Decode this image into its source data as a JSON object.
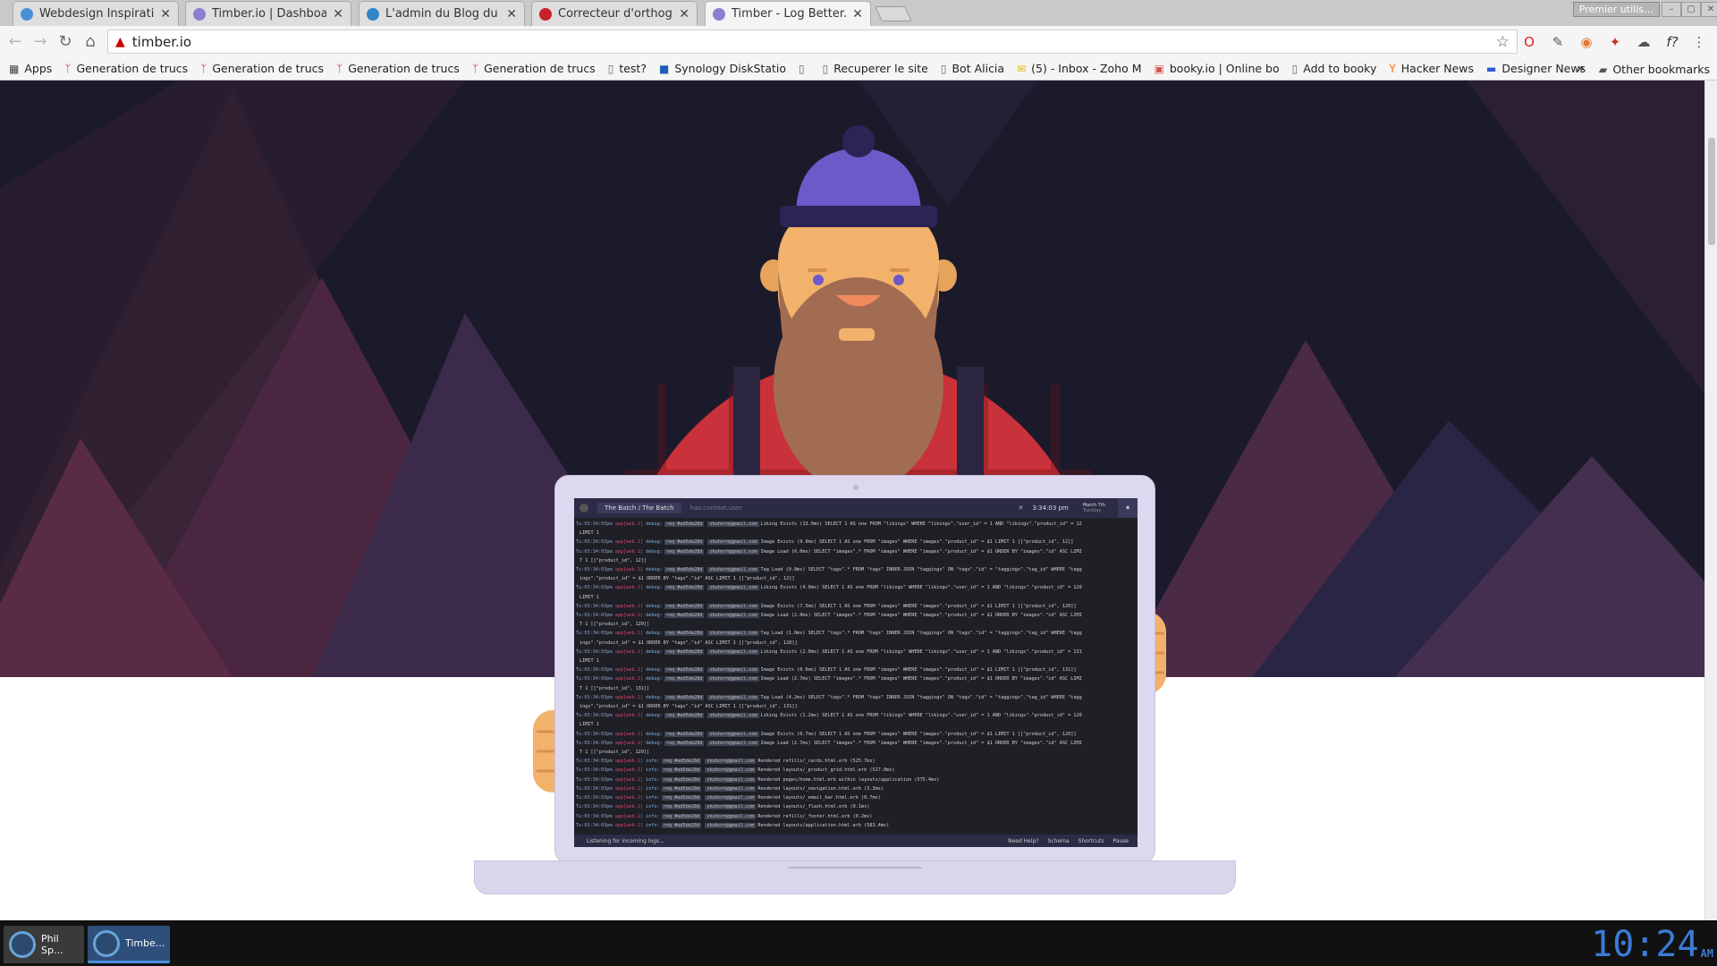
{
  "tabs": [
    {
      "title": "Webdesign Inspiration",
      "active": false,
      "favicon_color": "#4a90d9"
    },
    {
      "title": "Timber.io | Dashboard",
      "active": false,
      "favicon_color": "#8a7fd0"
    },
    {
      "title": "L'admin du Blog du We",
      "active": false,
      "favicon_color": "#2f86c9"
    },
    {
      "title": "Correcteur d'orthograp",
      "active": false,
      "favicon_color": "#c8212b"
    },
    {
      "title": "Timber - Log Better. Sc",
      "active": true,
      "favicon_color": "#8a7fd0"
    }
  ],
  "window": {
    "premier_label": "Premier utilis…"
  },
  "toolbar": {
    "url": "timber.io"
  },
  "bookmarks": [
    {
      "label": "Apps",
      "icon": "apps-grid-icon",
      "color": "#444"
    },
    {
      "label": "Generation de trucs",
      "icon": "bookmark-logo-icon",
      "color": "#c0392b"
    },
    {
      "label": "Generation de trucs",
      "icon": "bookmark-logo-icon",
      "color": "#c0392b"
    },
    {
      "label": "Generation de trucs",
      "icon": "bookmark-logo-icon",
      "color": "#c0392b"
    },
    {
      "label": "Generation de trucs",
      "icon": "bookmark-logo-icon",
      "color": "#c0392b"
    },
    {
      "label": "test?",
      "icon": "page-icon",
      "color": "#666"
    },
    {
      "label": "Synology DiskStatio",
      "icon": "dsm-icon",
      "color": "#1b5fb4"
    },
    {
      "label": "",
      "icon": "page-icon",
      "color": "#666"
    },
    {
      "label": "Recuperer le site",
      "icon": "page-icon",
      "color": "#666"
    },
    {
      "label": "Bot Alicia",
      "icon": "page-icon",
      "color": "#666"
    },
    {
      "label": "(5) - Inbox - Zoho M",
      "icon": "mail-icon",
      "color": "#e6b800"
    },
    {
      "label": "booky.io | Online bo",
      "icon": "booky-icon",
      "color": "#d9534f"
    },
    {
      "label": "Add to booky",
      "icon": "page-icon",
      "color": "#666"
    },
    {
      "label": "Hacker News",
      "icon": "hn-icon",
      "color": "#ff6600"
    },
    {
      "label": "Designer News",
      "icon": "dn-icon",
      "color": "#2d5bd6"
    }
  ],
  "bookmarks_more": "»",
  "other_bookmarks": "Other bookmarks",
  "screen": {
    "source": "The Batch / The Batch",
    "search_placeholder": "has:context.user",
    "time": "3:34:03 pm",
    "date": "March 7th",
    "date_sub": "Tuesday",
    "status": "Listening for incoming logs...",
    "footer_help": "Need Help?",
    "footer_schema": "Schema",
    "footer_shortcuts": "Shortcuts",
    "footer_pause": "Pause"
  },
  "logs": [
    {
      "ts": "Tu:03:34:03pm",
      "app": "app[web.1]",
      "lvl": "debug:",
      "msg": "Liking Exists (13.0ms) SELECT 1 AS one FROM \"likings\" WHERE \"likings\".\"user_id\" = 1 AND \"likings\".\"product_id\" = 12"
    },
    {
      "ts": "",
      "app": "",
      "lvl": "",
      "msg": "LIMIT 1"
    },
    {
      "ts": "Tu:03:34:03pm",
      "app": "app[web.1]",
      "lvl": "debug:",
      "msg": "Image Exists (9.0ms) SELECT 1 AS one FROM \"images\" WHERE \"images\".\"product_id\" = $1 LIMIT 1 [[\"product_id\", 12]]"
    },
    {
      "ts": "Tu:03:34:03pm",
      "app": "app[web.1]",
      "lvl": "debug:",
      "msg": "Image Load (6.0ms) SELECT \"images\".* FROM \"images\" WHERE \"images\".\"product_id\" = $1 ORDER BY \"images\".\"id\" ASC LIMI"
    },
    {
      "ts": "",
      "app": "",
      "lvl": "",
      "msg": "T 1 [[\"product_id\", 12]]"
    },
    {
      "ts": "Tu:03:34:03pm",
      "app": "app[web.1]",
      "lvl": "debug:",
      "msg": "Tag Load (0.8ms) SELECT \"tags\".* FROM \"tags\" INNER JOIN \"taggings\" ON \"tags\".\"id\" = \"taggings\".\"tag_id\" WHERE \"tagg"
    },
    {
      "ts": "",
      "app": "",
      "lvl": "",
      "msg": "ings\".\"product_id\" = $1 ORDER BY \"tags\".\"id\" ASC LIMIT 1 [[\"product_id\", 12]]"
    },
    {
      "ts": "Tu:03:34:03pm",
      "app": "app[web.1]",
      "lvl": "debug:",
      "msg": "Liking Exists (4.0ms) SELECT 1 AS one FROM \"likings\" WHERE \"likings\".\"user_id\" = 1 AND \"likings\".\"product_id\" = 120"
    },
    {
      "ts": "",
      "app": "",
      "lvl": "",
      "msg": "LIMIT 1"
    },
    {
      "ts": "Tu:03:34:03pm",
      "app": "app[web.1]",
      "lvl": "debug:",
      "msg": "Image Exists (7.5ms) SELECT 1 AS one FROM \"images\" WHERE \"images\".\"product_id\" = $1 LIMIT 1 [[\"product_id\", 120]]"
    },
    {
      "ts": "Tu:03:34:03pm",
      "app": "app[web.1]",
      "lvl": "debug:",
      "msg": "Image Load (2.0ms) SELECT \"images\".* FROM \"images\" WHERE \"images\".\"product_id\" = $1 ORDER BY \"images\".\"id\" ASC LIMI"
    },
    {
      "ts": "",
      "app": "",
      "lvl": "",
      "msg": "T 1 [[\"product_id\", 120]]"
    },
    {
      "ts": "Tu:03:34:03pm",
      "app": "app[web.1]",
      "lvl": "debug:",
      "msg": "Tag Load (1.0ms) SELECT \"tags\".* FROM \"tags\" INNER JOIN \"taggings\" ON \"tags\".\"id\" = \"taggings\".\"tag_id\" WHERE \"tagg"
    },
    {
      "ts": "",
      "app": "",
      "lvl": "",
      "msg": "ings\".\"product_id\" = $1 ORDER BY \"tags\".\"id\" ASC LIMIT 1 [[\"product_id\", 120]]"
    },
    {
      "ts": "Tu:03:34:03pm",
      "app": "app[web.1]",
      "lvl": "debug:",
      "msg": "Liking Exists (2.0ms) SELECT 1 AS one FROM \"likings\" WHERE \"likings\".\"user_id\" = 1 AND \"likings\".\"product_id\" = 131"
    },
    {
      "ts": "",
      "app": "",
      "lvl": "",
      "msg": "LIMIT 1"
    },
    {
      "ts": "Tu:03:34:03pm",
      "app": "app[web.1]",
      "lvl": "debug:",
      "msg": "Image Exists (0.6ms) SELECT 1 AS one FROM \"images\" WHERE \"images\".\"product_id\" = $1 LIMIT 1 [[\"product_id\", 131]]"
    },
    {
      "ts": "Tu:03:34:03pm",
      "app": "app[web.1]",
      "lvl": "debug:",
      "msg": "Image Load (2.7ms) SELECT \"images\".* FROM \"images\" WHERE \"images\".\"product_id\" = $1 ORDER BY \"images\".\"id\" ASC LIMI"
    },
    {
      "ts": "",
      "app": "",
      "lvl": "",
      "msg": "T 1 [[\"product_id\", 131]]"
    },
    {
      "ts": "Tu:03:34:03pm",
      "app": "app[web.1]",
      "lvl": "debug:",
      "msg": "Tag Load (4.2ms) SELECT \"tags\".* FROM \"tags\" INNER JOIN \"taggings\" ON \"tags\".\"id\" = \"taggings\".\"tag_id\" WHERE \"tagg"
    },
    {
      "ts": "",
      "app": "",
      "lvl": "",
      "msg": "ings\".\"product_id\" = $1 ORDER BY \"tags\".\"id\" ASC LIMIT 1 [[\"product_id\", 131]]"
    },
    {
      "ts": "Tu:03:34:03pm",
      "app": "app[web.1]",
      "lvl": "debug:",
      "msg": "Liking Exists (1.2ms) SELECT 1 AS one FROM \"likings\" WHERE \"likings\".\"user_id\" = 1 AND \"likings\".\"product_id\" = 120"
    },
    {
      "ts": "",
      "app": "",
      "lvl": "",
      "msg": "LIMIT 1"
    },
    {
      "ts": "Tu:03:34:03pm",
      "app": "app[web.1]",
      "lvl": "debug:",
      "msg": "Image Exists (0.7ms) SELECT 1 AS one FROM \"images\" WHERE \"images\".\"product_id\" = $1 LIMIT 1 [[\"product_id\", 120]]"
    },
    {
      "ts": "Tu:03:34:03pm",
      "app": "app[web.1]",
      "lvl": "debug:",
      "msg": "Image Load (2.7ms) SELECT \"images\".* FROM \"images\" WHERE \"images\".\"product_id\" = $1 ORDER BY \"images\".\"id\" ASC LIMI"
    },
    {
      "ts": "",
      "app": "",
      "lvl": "",
      "msg": "T 1 [[\"product_id\", 120]]"
    },
    {
      "ts": "Tu:03:34:03pm",
      "app": "app[web.1]",
      "lvl": "info:",
      "msg": "Rendered refills/_cards.html.erb (525.7ms)"
    },
    {
      "ts": "Tu:03:34:03pm",
      "app": "app[web.1]",
      "lvl": "info:",
      "msg": "Rendered layouts/_product_grid.html.erb (527.0ms)"
    },
    {
      "ts": "Tu:03:34:03pm",
      "app": "app[web.1]",
      "lvl": "info:",
      "msg": "Rendered pages/home.html.erb within layouts/application (575.4ms)"
    },
    {
      "ts": "Tu:03:34:03pm",
      "app": "app[web.1]",
      "lvl": "info:",
      "msg": "Rendered layouts/_navigation.html.erb (3.3ms)"
    },
    {
      "ts": "Tu:03:34:03pm",
      "app": "app[web.1]",
      "lvl": "info:",
      "msg": "Rendered layouts/_email_bar.html.erb (0.7ms)"
    },
    {
      "ts": "Tu:03:34:03pm",
      "app": "app[web.1]",
      "lvl": "info:",
      "msg": "Rendered layouts/_flash.html.erb (0.1ms)"
    },
    {
      "ts": "Tu:03:34:03pm",
      "app": "app[web.1]",
      "lvl": "info:",
      "msg": "Rendered refills/_footer.html.erb (0.2ms)"
    },
    {
      "ts": "Tu:03:34:03pm",
      "app": "app[web.1]",
      "lvl": "info:",
      "msg": "Rendered layouts/application.html.erb (583.4ms)"
    }
  ],
  "log_tags": {
    "req": "req #ad5de28d",
    "user": "zkuhorn@gmail.com"
  },
  "taskbar": [
    {
      "label": "Phil Sp...",
      "active": false
    },
    {
      "label": "Timbe...",
      "active": true
    }
  ],
  "clock": {
    "time": "10:24",
    "ampm": "AM"
  },
  "colors": {
    "hero_bg": "#1b1a2b",
    "beanie": "#6b5bc9",
    "beard": "#a26c52",
    "skin": "#f3b26b",
    "shirt": "#c9323a",
    "accent_blue": "#3a7bd5"
  }
}
